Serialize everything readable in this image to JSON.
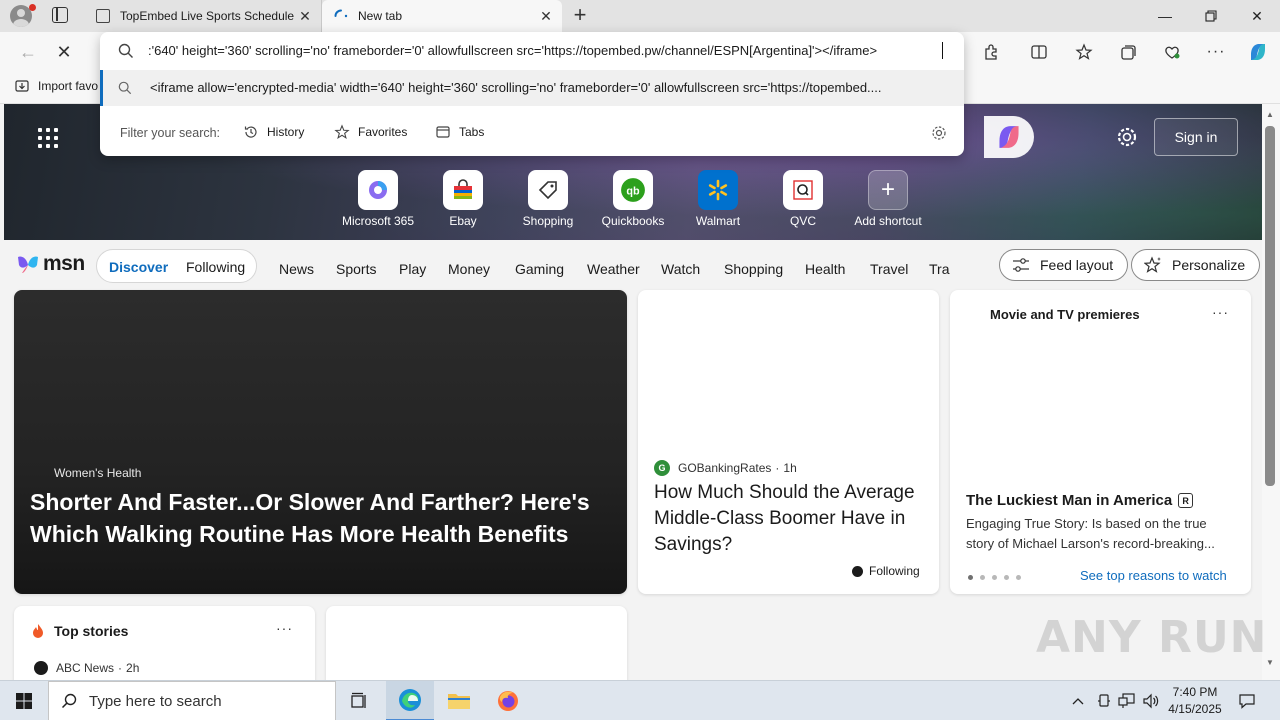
{
  "browser": {
    "tabs": [
      {
        "title": "TopEmbed Live Sports Schedule",
        "active": false
      },
      {
        "title": "New tab",
        "active": true
      }
    ],
    "address_value": ":'640' height='360' scrolling='no' frameborder='0' allowfullscreen src='https://topembed.pw/channel/ESPN[Argentina]'></iframe>",
    "suggestion": "<iframe allow='encrypted-media' width='640' height='360' scrolling='no' frameborder='0' allowfullscreen src='https://topembed....",
    "filter_label": "Filter your search:",
    "filters": [
      "History",
      "Favorites",
      "Tabs"
    ],
    "bookmark_label": "Import favo"
  },
  "hero": {
    "signin_label": "Sign in",
    "shortcuts": [
      {
        "label": "Microsoft 365",
        "icon": "microsoft-365-icon"
      },
      {
        "label": "Ebay",
        "icon": "ebay-bag-icon"
      },
      {
        "label": "Shopping",
        "icon": "shopping-tag-icon"
      },
      {
        "label": "Quickbooks",
        "icon": "quickbooks-icon"
      },
      {
        "label": "Walmart",
        "icon": "walmart-spark-icon"
      },
      {
        "label": "QVC",
        "icon": "qvc-icon"
      },
      {
        "label": "Add shortcut",
        "icon": "plus-icon"
      }
    ]
  },
  "nav": {
    "logo": "msn",
    "pivots": [
      "Discover",
      "Following"
    ],
    "categories": [
      "News",
      "Sports",
      "Play",
      "Money",
      "Gaming",
      "Weather",
      "Watch",
      "Shopping",
      "Health",
      "Travel",
      "Tra"
    ],
    "feed_layout": "Feed layout",
    "personalize": "Personalize"
  },
  "cards": {
    "hero": {
      "kicker": "Women's Health",
      "title": "Shorter And Faster...Or Slower And Farther? Here's Which Walking Routine Has More Health Benefits"
    },
    "mid": {
      "source": "GOBankingRates",
      "time": "1h",
      "title": "How Much Should the Average Middle-Class Boomer Have in Savings?",
      "following": "Following"
    },
    "right": {
      "header": "Movie and TV premieres",
      "title": "The Luckiest Man in America",
      "rating": "R",
      "description": "Engaging True Story: Is based on the true story of Michael Larson's record-breaking...",
      "link": "See top reasons to watch"
    },
    "top_stories": {
      "header": "Top stories",
      "source": "ABC News",
      "time": "2h"
    }
  },
  "watermark": "ANY RUN",
  "taskbar": {
    "search_placeholder": "Type here to search",
    "time": "7:40 PM",
    "date": "4/15/2025"
  },
  "colors": {
    "accent": "#0f6cbd",
    "hero_start": "#20262d",
    "hero_mid": "#54466c",
    "taskbar": "#dfe6ee"
  }
}
